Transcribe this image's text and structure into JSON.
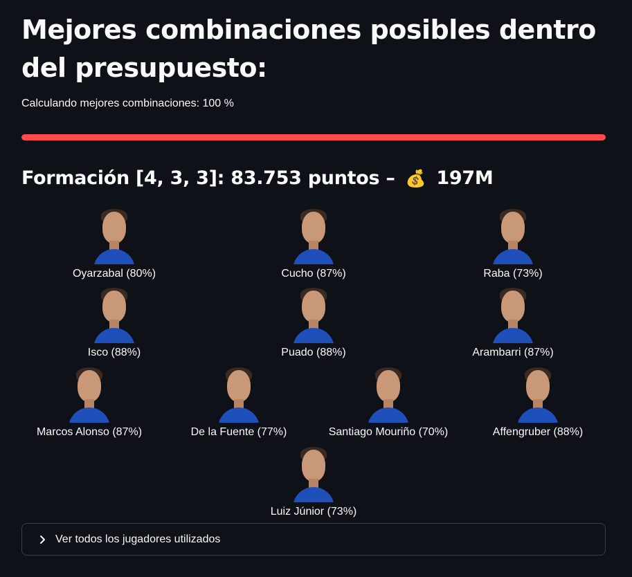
{
  "title": "Mejores combinaciones posibles dentro del presupuesto:",
  "progress": {
    "text": "Calculando mejores combinaciones: 100 %",
    "value_percent": 100,
    "color": "#ff4b4b"
  },
  "formation": {
    "label": "Formación [4, 3, 3]: 83.753 puntos –",
    "money_icon": "💰",
    "budget": "197M"
  },
  "rows": [
    [
      {
        "name": "Oyarzabal (80%)",
        "icon": "player-photo"
      },
      {
        "name": "Cucho (87%)",
        "icon": "player-photo"
      },
      {
        "name": "Raba (73%)",
        "icon": "player-photo"
      }
    ],
    [
      {
        "name": "Isco (88%)",
        "icon": "player-photo"
      },
      {
        "name": "Puado (88%)",
        "icon": "player-photo"
      },
      {
        "name": "Arambarri (87%)",
        "icon": "player-photo"
      }
    ],
    [
      {
        "name": "Marcos Alonso (87%)",
        "icon": "player-photo"
      },
      {
        "name": "De la Fuente (77%)",
        "icon": "player-photo"
      },
      {
        "name": "Santiago Mouriño (70%)",
        "icon": "player-photo"
      },
      {
        "name": "Affengruber (88%)",
        "icon": "player-photo"
      }
    ],
    [
      {
        "name": "Luiz Júnior (73%)",
        "icon": "player-photo"
      }
    ]
  ],
  "expander": {
    "label": "Ver todos los jugadores utilizados",
    "icon": "chevron-right-icon"
  },
  "colors": {
    "background": "#0e1117",
    "text": "#fafafa",
    "accent": "#ff4b4b"
  }
}
